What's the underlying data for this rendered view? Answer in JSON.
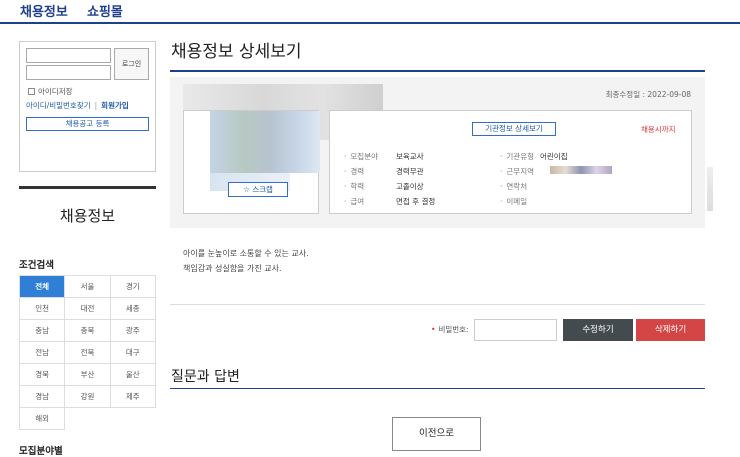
{
  "topnav": {
    "jobs": "채용정보",
    "mall": "쇼핑몰"
  },
  "login": {
    "button": "로그인",
    "save_id": "아이디저장",
    "find": "아이디/비밀번호찾기",
    "join": "회원가입",
    "register_job": "채용공고 등록"
  },
  "sidebar": {
    "title": "채용정보",
    "condition_label": "조건검색",
    "regions": [
      "전체",
      "서울",
      "경기",
      "인천",
      "대전",
      "세종",
      "충남",
      "충북",
      "광주",
      "전남",
      "전북",
      "대구",
      "경북",
      "부산",
      "울산",
      "경남",
      "강원",
      "제주",
      "해외"
    ],
    "active_region": "전체",
    "recruit_field_label": "모집분야별"
  },
  "main": {
    "title": "채용정보 상세보기",
    "modified": "최종수정일 : 2022-09-08",
    "org_info_button": "기관정보 상세보기",
    "hiring_status": "채용시까지",
    "scrap_button": "스크랩",
    "fields_left": [
      {
        "key": "모집분야",
        "value": "보육교사"
      },
      {
        "key": "경력",
        "value": "경력무관"
      },
      {
        "key": "학력",
        "value": "고졸이상"
      },
      {
        "key": "급여",
        "value": "면접 후 결정"
      }
    ],
    "fields_right": [
      {
        "key": "기관유형",
        "value": "어린이집"
      },
      {
        "key": "근무지역",
        "value": ""
      },
      {
        "key": "연락처",
        "value": ""
      },
      {
        "key": "이메일",
        "value": ""
      }
    ],
    "description": [
      "아이를 눈높이로 소통할 수 있는 교사.",
      "책임감과 성실함을 가진 교사."
    ],
    "password_label": "비밀번호:",
    "edit_button": "수정하기",
    "delete_button": "삭제하기",
    "qa_title": "질문과 답변",
    "prev_button": "이전으로"
  }
}
